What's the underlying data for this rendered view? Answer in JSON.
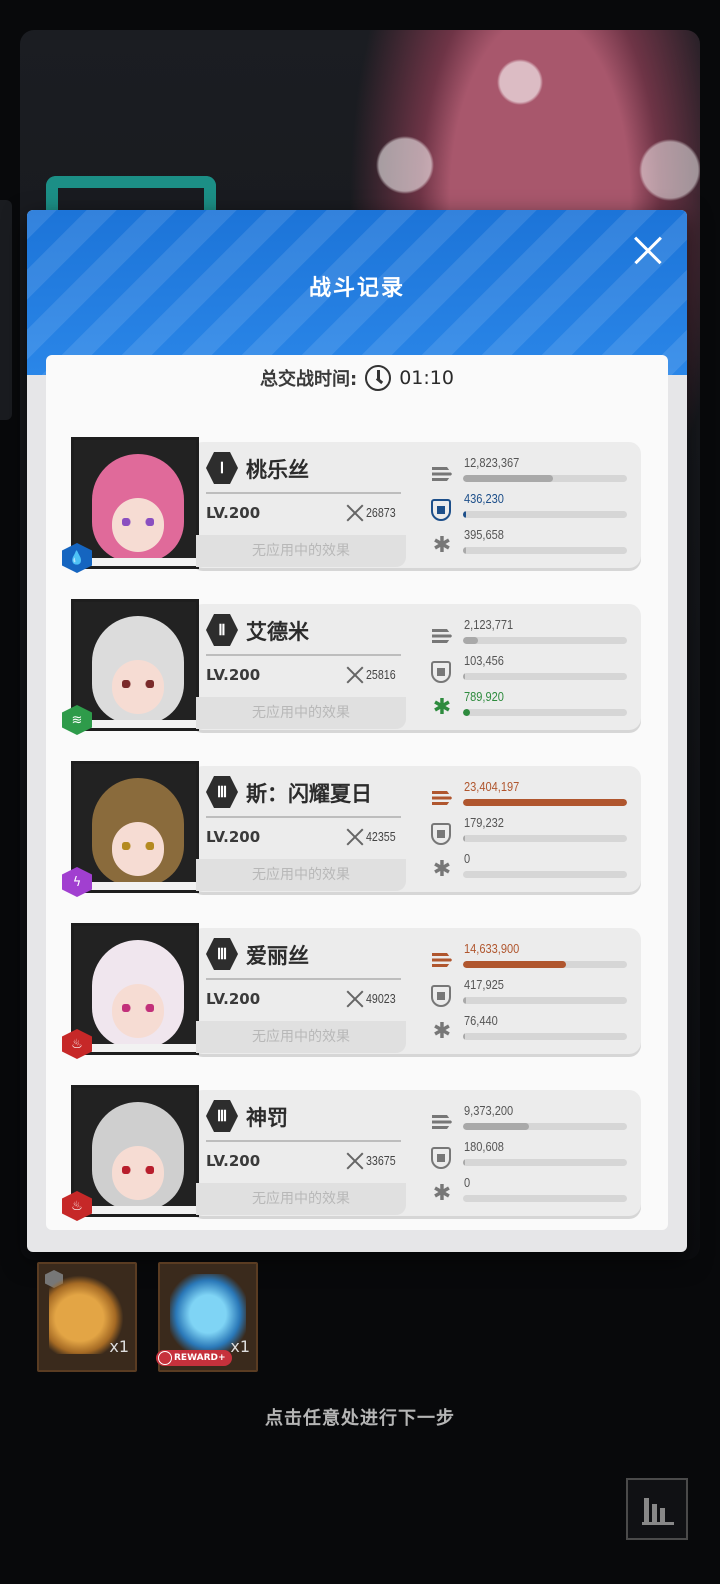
{
  "modal": {
    "title": "战斗记录",
    "battle_time_label": "总交战时间:",
    "battle_time_value": "01:10",
    "effect_placeholder": "无应用中的效果"
  },
  "characters": [
    {
      "name": "桃乐丝",
      "rank": "Ⅰ",
      "level": "LV.200",
      "power": "26873",
      "element": "water",
      "element_color": "#1565c0",
      "hair_color": "#e06a9a",
      "eye_color": "#8a4fc0",
      "damage": "12,823,367",
      "damage_fraction": 0.55,
      "damage_taken": "436,230",
      "damage_taken_fraction": 0.02,
      "healing": "395,658",
      "healing_fraction": 0.02,
      "highlight": "damage_taken"
    },
    {
      "name": "艾德米",
      "rank": "Ⅱ",
      "level": "LV.200",
      "power": "25816",
      "element": "wind",
      "element_color": "#2e9b4a",
      "hair_color": "#dcdcdc",
      "eye_color": "#7a2a2a",
      "damage": "2,123,771",
      "damage_fraction": 0.09,
      "damage_taken": "103,456",
      "damage_taken_fraction": 0.01,
      "healing": "789,920",
      "healing_fraction": 0.04,
      "highlight": "healing"
    },
    {
      "name": "斯：闪耀夏日",
      "rank": "Ⅲ",
      "level": "LV.200",
      "power": "42355",
      "element": "electric",
      "element_color": "#a13fd0",
      "hair_color": "#8a6b3c",
      "eye_color": "#b48a20",
      "damage": "23,404,197",
      "damage_fraction": 1.0,
      "damage_taken": "179,232",
      "damage_taken_fraction": 0.01,
      "healing": "0",
      "healing_fraction": 0,
      "highlight": "damage"
    },
    {
      "name": "爱丽丝",
      "rank": "Ⅲ",
      "level": "LV.200",
      "power": "49023",
      "element": "fire",
      "element_color": "#c62828",
      "hair_color": "#f0e6ee",
      "eye_color": "#c2307a",
      "damage": "14,633,900",
      "damage_fraction": 0.63,
      "damage_taken": "417,925",
      "damage_taken_fraction": 0.02,
      "healing": "76,440",
      "healing_fraction": 0.01,
      "highlight": "damage"
    },
    {
      "name": "神罚",
      "rank": "Ⅲ",
      "level": "LV.200",
      "power": "33675",
      "element": "fire",
      "element_color": "#c62828",
      "hair_color": "#cfcfcf",
      "eye_color": "#b81e2c",
      "damage": "9,373,200",
      "damage_fraction": 0.4,
      "damage_taken": "180,608",
      "damage_taken_fraction": 0.01,
      "healing": "0",
      "healing_fraction": 0,
      "highlight": "none"
    }
  ],
  "rewards": [
    {
      "item": "boots",
      "quantity": "x1",
      "tag": ""
    },
    {
      "item": "crystal",
      "quantity": "x1",
      "tag": "REWARD+"
    }
  ],
  "footer": {
    "tap_hint": "点击任意处进行下一步"
  },
  "colors": {
    "header_blue": "#1c74d8",
    "damage_highlight": "#b0562e",
    "shield_highlight": "#1d4f8a",
    "heal_highlight": "#2e8b3e",
    "neutral_bar": "#a9a9a9"
  }
}
